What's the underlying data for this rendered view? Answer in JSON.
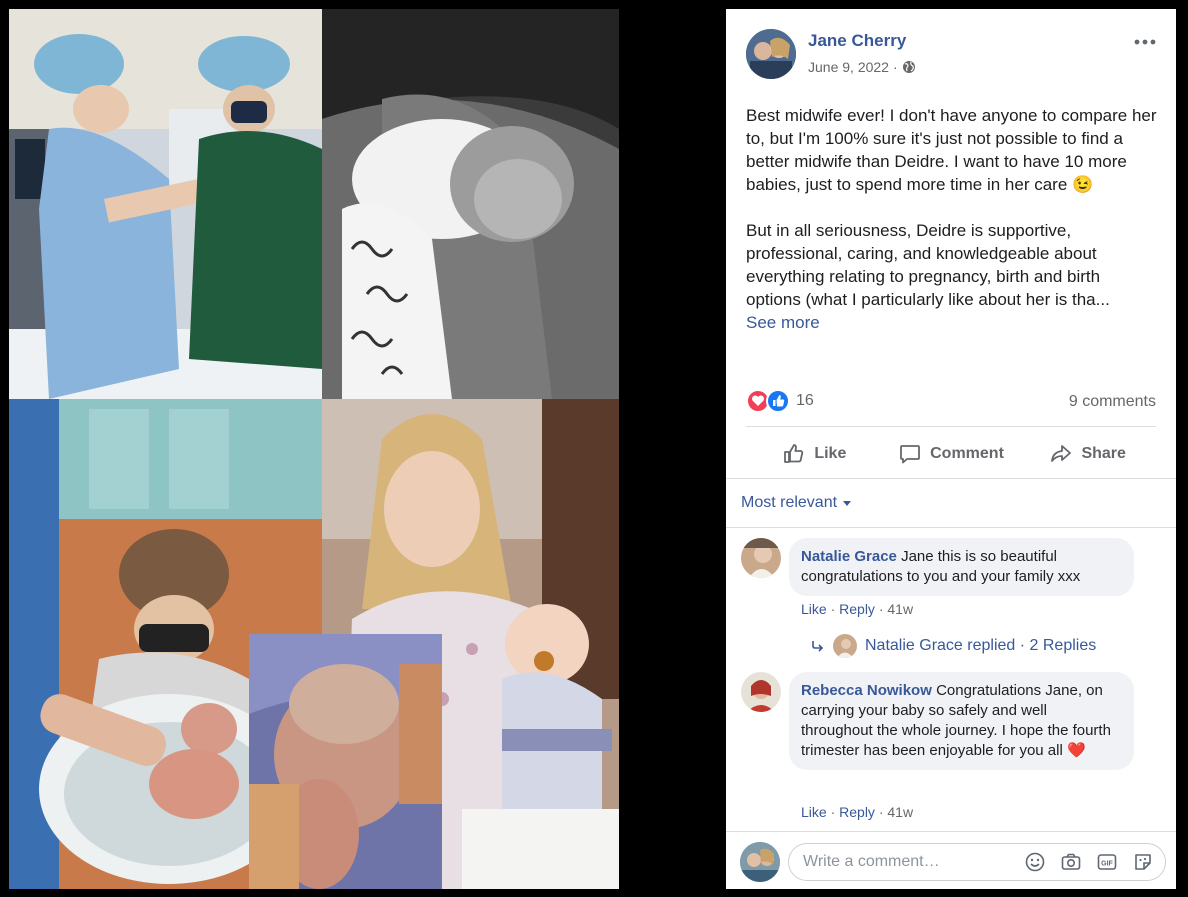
{
  "post": {
    "author": "Jane Cherry",
    "date": "June 9, 2022",
    "meta_separator": "·",
    "paragraph1": "Best midwife ever! I don't have anyone to compare her to, but I'm 100% sure it's just not possible to find a better midwife than Deidre. I want to have 10 more babies, just to spend more time in her care 😉",
    "paragraph2": "But in all seriousness, Deidre is supportive, professional, caring, and knowledgeable about everything relating to pregnancy, birth and birth options (what I particularly like about her is tha...",
    "see_more": "See more"
  },
  "stats": {
    "reactions": "16",
    "comments": "9 comments",
    "reaction_icons": [
      "love-icon",
      "like-icon"
    ]
  },
  "actions": {
    "like": "Like",
    "comment": "Comment",
    "share": "Share"
  },
  "sort_label": "Most relevant",
  "comments": [
    {
      "author": "Natalie Grace",
      "text": "Jane this is so beautiful congratulations to you and your family xxx",
      "like": "Like",
      "reply": "Reply",
      "time": "41w"
    },
    {
      "author": "Rebecca Nowikow",
      "text": "Congratulations Jane, on carrying your baby so safely and well throughout the whole journey. I hope the fourth trimester has been enjoyable for you all ❤️",
      "like": "Like",
      "reply": "Reply",
      "time": "41w"
    }
  ],
  "replies": {
    "label": "Natalie Grace replied · 2 Replies"
  },
  "composer": {
    "placeholder": "Write a comment…",
    "icons": [
      "emoji-icon",
      "camera-icon",
      "gif-icon",
      "sticker-icon"
    ]
  },
  "colors": {
    "link_blue": "#385898",
    "meta_gray": "#65676b",
    "bubble_bg": "#f0f2f5",
    "like_blue": "#1877f2",
    "love_red": "#f33e58"
  }
}
